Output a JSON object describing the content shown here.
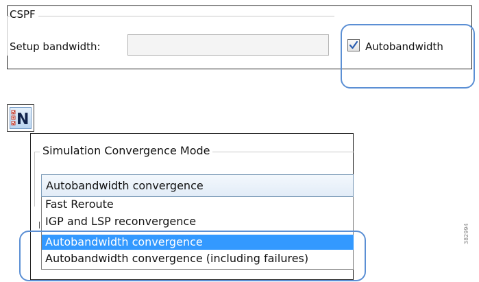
{
  "cspf": {
    "title": "CSPF",
    "setup_bandwidth_label": "Setup bandwidth:",
    "setup_bandwidth_value": "",
    "autobandwidth_label": "Autobandwidth",
    "autobandwidth_checked": true
  },
  "app_icon": {
    "icon": "n-network-icon",
    "letter": "N"
  },
  "simulation": {
    "title": "Simulation Convergence Mode",
    "selected_value": "Autobandwidth convergence",
    "options": [
      {
        "label": "Fast Reroute",
        "selected": false
      },
      {
        "label": "IGP and LSP reconvergence",
        "selected": false
      },
      {
        "label": "Autobandwidth convergence",
        "selected": true
      },
      {
        "label": "Autobandwidth convergence (including failures)",
        "selected": false
      }
    ]
  },
  "colors": {
    "callout": "#5b8fd4",
    "selection": "#3399ff",
    "check": "#2a5db0"
  },
  "figure_id": "382994"
}
